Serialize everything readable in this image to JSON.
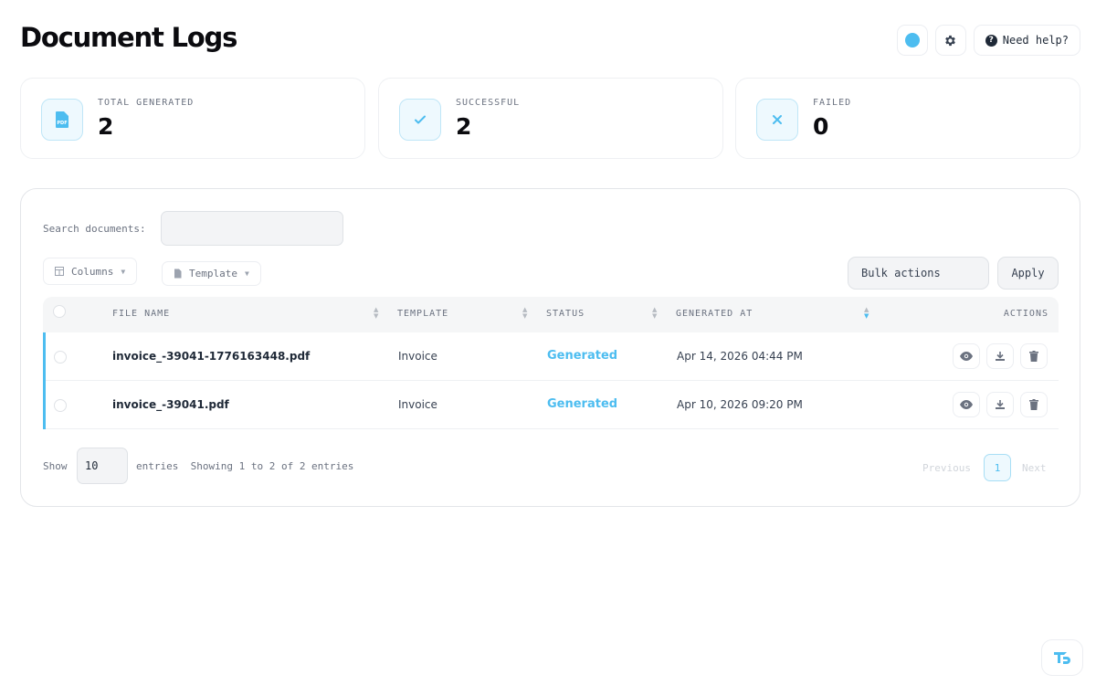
{
  "page": {
    "title": "Document Logs"
  },
  "header": {
    "help_label": "Need help?",
    "accent_color": "#4dbdf0"
  },
  "stats": [
    {
      "label": "TOTAL GENERATED",
      "value": "2",
      "icon": "pdf-file-icon",
      "icon_text": "PDF"
    },
    {
      "label": "SUCCESSFUL",
      "value": "2",
      "icon": "check-icon"
    },
    {
      "label": "FAILED",
      "value": "0",
      "icon": "x-icon"
    }
  ],
  "toolbar": {
    "search_label": "Search documents:",
    "search_value": "",
    "columns_label": "Columns",
    "template_filter_label": "Template",
    "bulk_actions_label": "Bulk actions",
    "apply_label": "Apply"
  },
  "table": {
    "headers": [
      "FILE NAME",
      "TEMPLATE",
      "STATUS",
      "GENERATED AT",
      "ACTIONS"
    ],
    "rows": [
      {
        "file_name": "invoice_-39041-1776163448.pdf",
        "template": "Invoice",
        "status": "Generated",
        "generated_at": "Apr 14, 2026 04:44 PM"
      },
      {
        "file_name": "invoice_-39041.pdf",
        "template": "Invoice",
        "status": "Generated",
        "generated_at": "Apr 10, 2026 09:20 PM"
      }
    ]
  },
  "footer": {
    "show_label": "Show",
    "page_size": "10",
    "entries_label": "entries",
    "info": "Showing 1 to 2 of 2 entries",
    "prev_label": "Previous",
    "current_page": "1",
    "next_label": "Next"
  }
}
